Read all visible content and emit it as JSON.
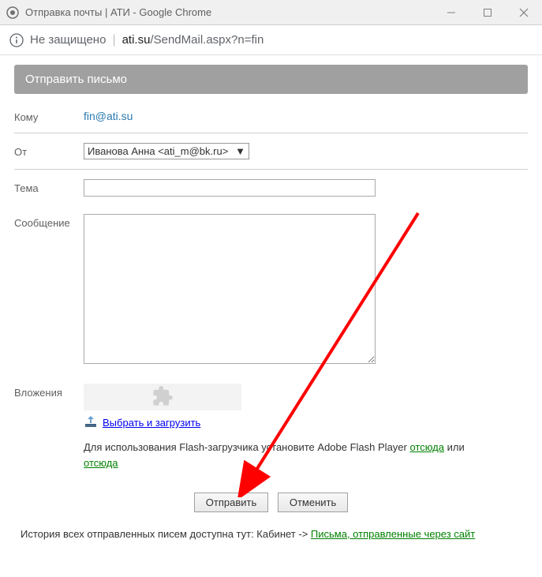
{
  "window": {
    "title": "Отправка почты | АТИ - Google Chrome"
  },
  "urlbar": {
    "insecure_label": "Не защищено",
    "domain": "ati.su",
    "path": "/SendMail.aspx?n=fin"
  },
  "header": {
    "title": "Отправить письмо"
  },
  "form": {
    "to_label": "Кому",
    "to_value": "fin@ati.su",
    "from_label": "От",
    "from_value": "Иванова Анна <ati_m@bk.ru>",
    "subject_label": "Тема",
    "subject_value": "",
    "message_label": "Сообщение",
    "message_value": "",
    "attachments_label": "Вложения",
    "attach_link": "Выбрать и загрузить",
    "flash_text_1": "Для использования Flash-загрузчика установите Adobe Flash Player ",
    "flash_link_1": "отсюда",
    "flash_text_2": " или ",
    "flash_link_2": "отсюда"
  },
  "buttons": {
    "submit": "Отправить",
    "cancel": "Отменить"
  },
  "history": {
    "text_1": "История всех отправленных писем доступна тут: Кабинет -> ",
    "link": "Письма, отправленные через сайт"
  }
}
